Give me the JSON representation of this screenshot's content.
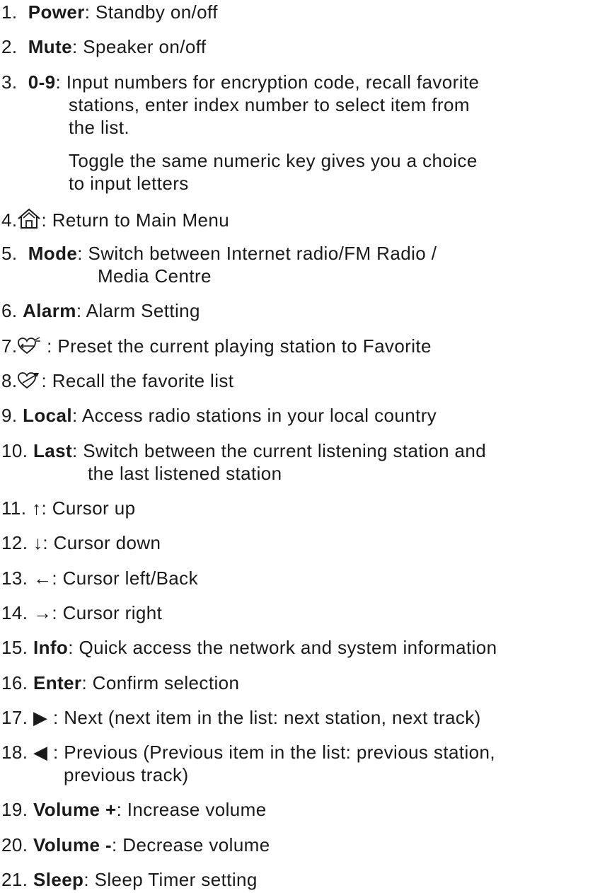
{
  "items": [
    {
      "num": "1.",
      "key": "Power",
      "desc": ": Standby on/off"
    },
    {
      "num": "2.",
      "key": "Mute",
      "desc": ": Speaker on/off"
    },
    {
      "num": "3.",
      "key": "0-9",
      "desc": ": Input numbers for encryption code, recall favorite",
      "cont": [
        "stations, enter index number to select item from",
        "the list."
      ],
      "extra": [
        "Toggle the same numeric key gives you a choice",
        "to input letters"
      ]
    },
    {
      "num": "4.",
      "icon": "home-icon",
      "desc": ": Return to Main Menu"
    },
    {
      "num": "5.",
      "key": "Mode",
      "desc": ": Switch between Internet radio/FM Radio /",
      "cont": [
        "Media Centre"
      ]
    },
    {
      "num": "6.",
      "key": "Alarm",
      "desc": ": Alarm Setting"
    },
    {
      "num": "7.",
      "icon": "heart-add-icon",
      "desc": " : Preset the current playing station to Favorite"
    },
    {
      "num": "8.",
      "icon": "heart-arrow-icon",
      "desc": ": Recall the favorite list"
    },
    {
      "num": "9.",
      "key": "Local",
      "desc": ": Access radio stations in your local country"
    },
    {
      "num": "10.",
      "key": "Last",
      "desc": ": Switch between the current listening station and",
      "cont": [
        "the last listened station"
      ]
    },
    {
      "num": "11.",
      "sym": "↑",
      "desc": ": Cursor up"
    },
    {
      "num": "12.",
      "sym": "↓",
      "desc": ": Cursor down"
    },
    {
      "num": "13.",
      "sym": "←",
      "desc": ": Cursor left/Back"
    },
    {
      "num": "14.",
      "sym": "→",
      "desc": ": Cursor right"
    },
    {
      "num": "15.",
      "key": "Info",
      "desc": ": Quick access the network and system information"
    },
    {
      "num": "16.",
      "key": "Enter",
      "desc": ": Confirm selection"
    },
    {
      "num": "17.",
      "sym": "▶",
      "desc": " : Next (next item in the list: next station, next track)"
    },
    {
      "num": "18.",
      "sym": "◀",
      "desc": " : Previous (Previous item in the list: previous station,",
      "cont": [
        "previous track)"
      ]
    },
    {
      "num": "19.",
      "key": "Volume +",
      "desc": ": Increase volume"
    },
    {
      "num": "20.",
      "key": "Volume -",
      "desc": ": Decrease volume"
    },
    {
      "num": "21.",
      "key": "Sleep",
      "desc": ": Sleep Timer setting"
    }
  ]
}
